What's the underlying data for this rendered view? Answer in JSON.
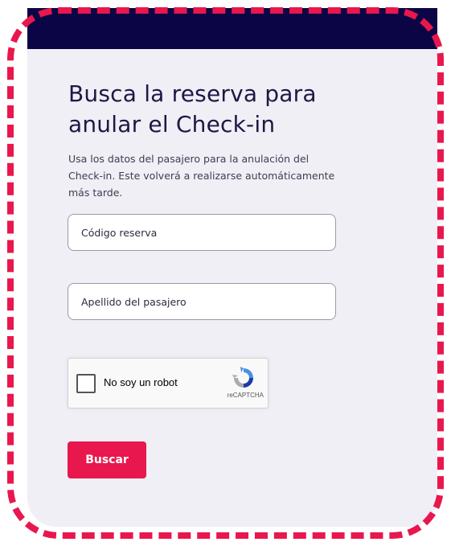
{
  "header": {
    "color": "#0c0545"
  },
  "form": {
    "title": "Busca la reserva para anular el Check-in",
    "description": "Usa los datos del pasajero para la anulación del Check-in. Este volverá a realizarse automáticamente más tarde.",
    "booking_code_placeholder": "Código reserva",
    "surname_placeholder": "Apellido del pasajero",
    "submit_label": "Buscar"
  },
  "captcha": {
    "label": "No soy un robot",
    "brand": "reCAPTCHA",
    "checked": false,
    "icon": "recaptcha-icon"
  },
  "colors": {
    "accent": "#e8174d",
    "card_background": "#efeff5",
    "title_text": "#1d1845"
  }
}
